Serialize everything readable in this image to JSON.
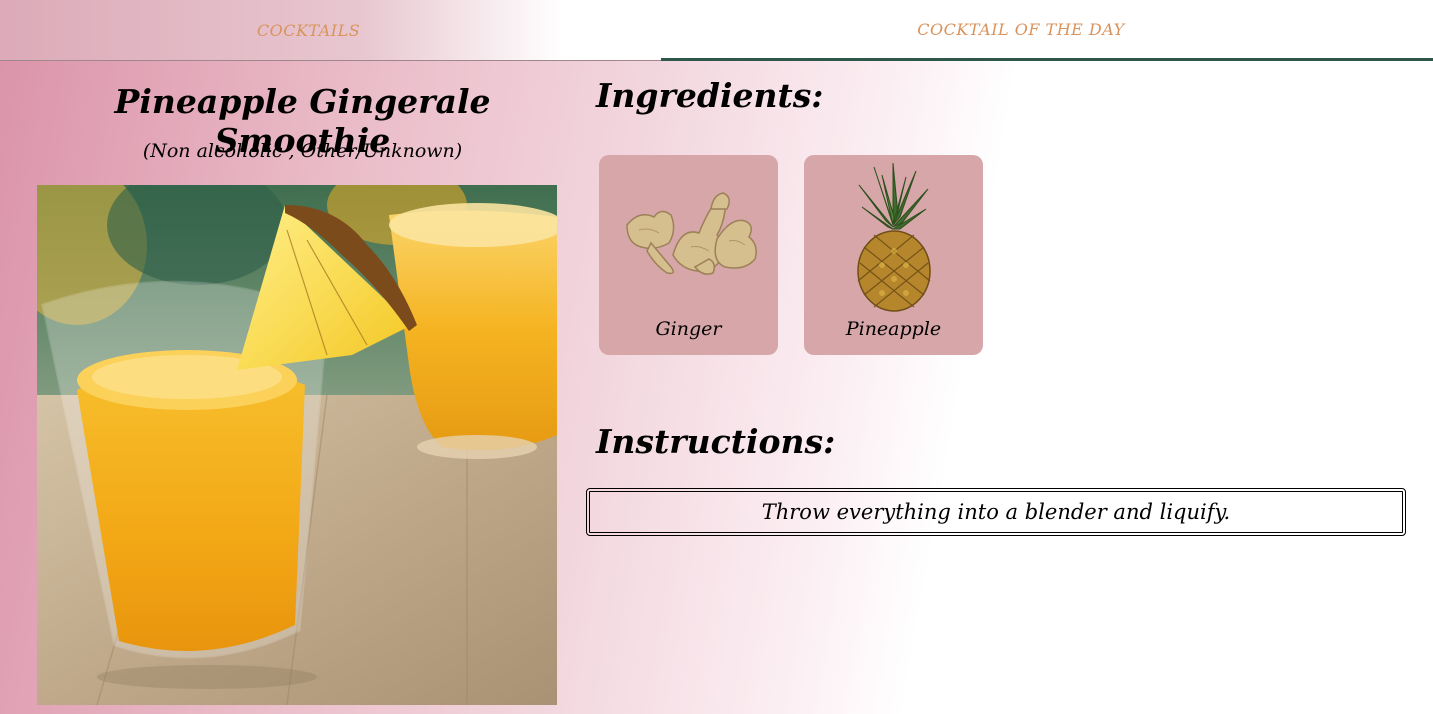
{
  "nav": {
    "tabs": [
      {
        "label": "COCKTAILS"
      },
      {
        "label": "COCKTAIL OF THE DAY"
      }
    ],
    "active_tab": "COCKTAIL OF THE DAY"
  },
  "drink": {
    "name": "Pineapple Gingerale Smoothie",
    "meta": "(Non alcoholic , Other/Unknown)",
    "photo_icon": "pineapple-smoothie-photo"
  },
  "ingredients": {
    "heading": "Ingredients:",
    "items": [
      {
        "name": "Ginger",
        "icon": "ginger-root-image"
      },
      {
        "name": "Pineapple",
        "icon": "pineapple-image"
      }
    ]
  },
  "instructions": {
    "heading": "Instructions:",
    "text": "Throw everything into a blender and liquify."
  },
  "colors": {
    "tab_text": "#d9935d",
    "active_tab_underline": "#2f5749",
    "card_background": "#d6a6a9",
    "page_gradient_start": "#db93a9"
  }
}
